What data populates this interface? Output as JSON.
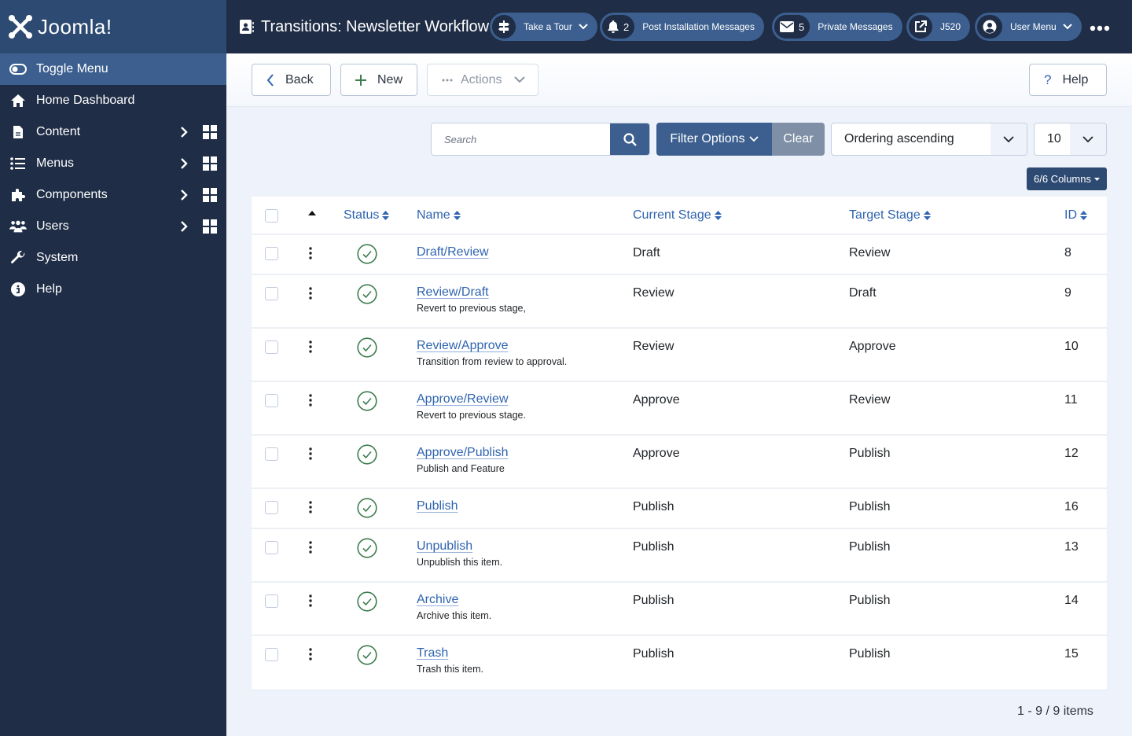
{
  "brand": {
    "name": "Joomla!"
  },
  "sidebar": {
    "toggle_label": "Toggle Menu",
    "items": [
      {
        "label": "Home Dashboard",
        "icon": "home-icon",
        "has_submenu": false
      },
      {
        "label": "Content",
        "icon": "file-icon",
        "has_submenu": true
      },
      {
        "label": "Menus",
        "icon": "list-icon",
        "has_submenu": true
      },
      {
        "label": "Components",
        "icon": "puzzle-icon",
        "has_submenu": true
      },
      {
        "label": "Users",
        "icon": "users-icon",
        "has_submenu": true
      },
      {
        "label": "System",
        "icon": "wrench-icon",
        "has_submenu": false
      },
      {
        "label": "Help",
        "icon": "info-icon",
        "has_submenu": false
      }
    ]
  },
  "header": {
    "title": "Transitions: Newsletter Workflow",
    "tour": {
      "label": "Take a Tour"
    },
    "post_install": {
      "count": "2",
      "label": "Post Installation Messages"
    },
    "private_messages": {
      "count": "5",
      "label": "Private Messages"
    },
    "site": {
      "label": "J520"
    },
    "user_menu": {
      "label": "User Menu"
    }
  },
  "toolbar": {
    "back_label": "Back",
    "new_label": "New",
    "actions_label": "Actions",
    "help_label": "Help"
  },
  "filters": {
    "search_placeholder": "Search",
    "search_value": "",
    "filter_options_label": "Filter Options",
    "clear_label": "Clear",
    "ordering_selected": "Ordering ascending",
    "limit_selected": "10",
    "columns_label": "6/6 Columns"
  },
  "table": {
    "columns": {
      "status": "Status",
      "name": "Name",
      "current_stage": "Current Stage",
      "target_stage": "Target Stage",
      "id": "ID"
    },
    "rows": [
      {
        "name": "Draft/Review",
        "description": "",
        "current": "Draft",
        "target": "Review",
        "id": "8",
        "status": "enabled"
      },
      {
        "name": "Review/Draft",
        "description": "Revert to previous stage,",
        "current": "Review",
        "target": "Draft",
        "id": "9",
        "status": "enabled"
      },
      {
        "name": "Review/Approve",
        "description": "Transition from review to approval.",
        "current": "Review",
        "target": "Approve",
        "id": "10",
        "status": "enabled"
      },
      {
        "name": "Approve/Review",
        "description": "Revert to previous stage.",
        "current": "Approve",
        "target": "Review",
        "id": "11",
        "status": "enabled"
      },
      {
        "name": "Approve/Publish",
        "description": "Publish and Feature",
        "current": "Approve",
        "target": "Publish",
        "id": "12",
        "status": "enabled"
      },
      {
        "name": "Publish",
        "description": "",
        "current": "Publish",
        "target": "Publish",
        "id": "16",
        "status": "enabled"
      },
      {
        "name": "Unpublish",
        "description": "Unpublish this item.",
        "current": "Publish",
        "target": "Publish",
        "id": "13",
        "status": "enabled"
      },
      {
        "name": "Archive",
        "description": "Archive this item.",
        "current": "Publish",
        "target": "Publish",
        "id": "14",
        "status": "enabled"
      },
      {
        "name": "Trash",
        "description": "Trash this item.",
        "current": "Publish",
        "target": "Publish",
        "id": "15",
        "status": "enabled"
      }
    ]
  },
  "pagination": {
    "info": "1 - 9 / 9 items"
  },
  "colors": {
    "primary": "#3c5f8f",
    "header_bg": "#1f2d46",
    "link": "#2f64b0",
    "status_ok": "#3e7d4e"
  }
}
